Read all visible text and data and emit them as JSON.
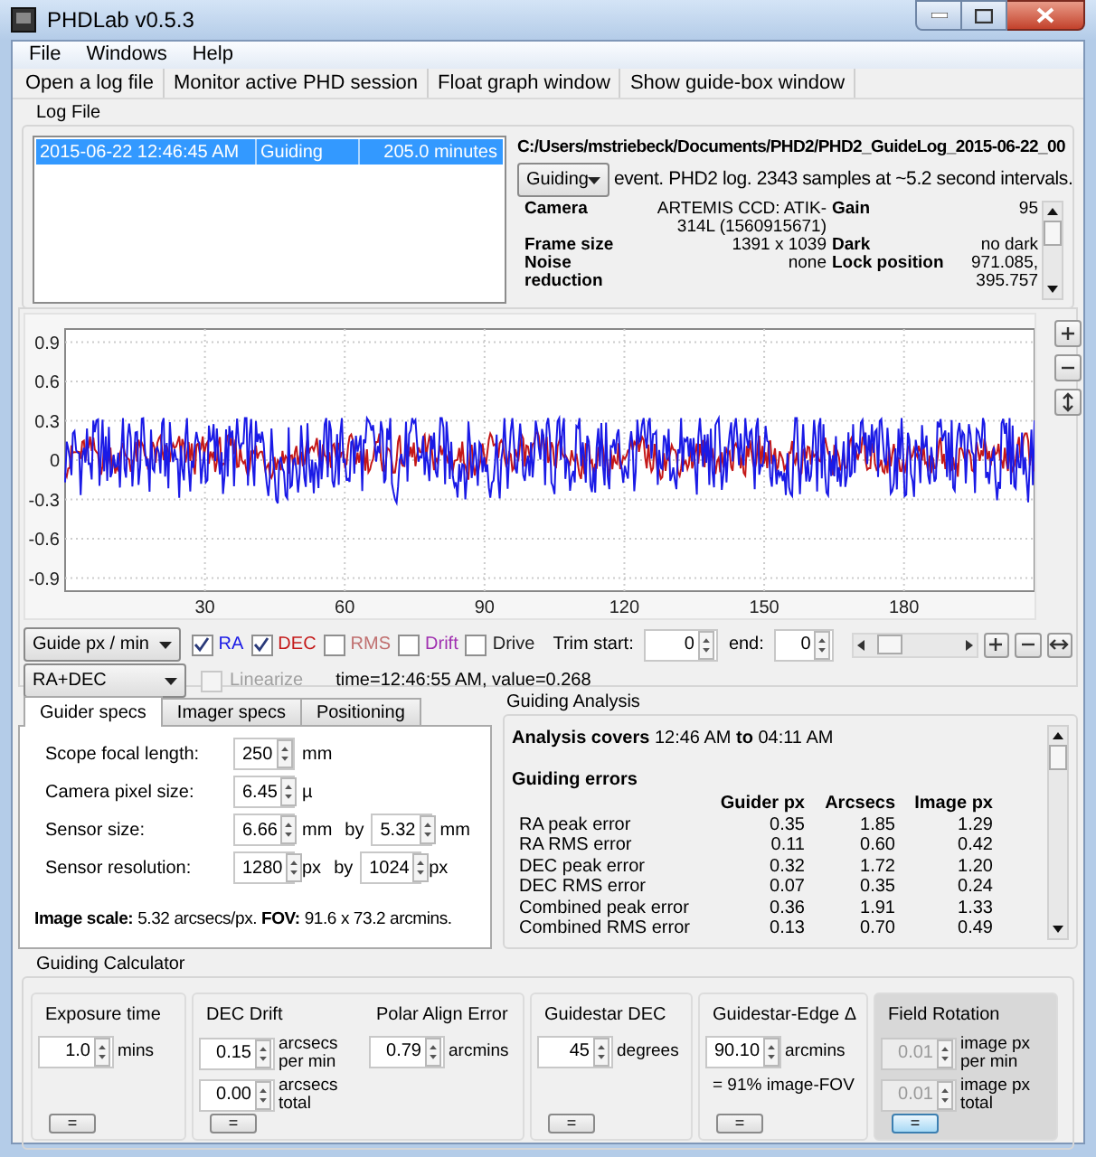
{
  "window": {
    "title": "PHDLab v0.5.3"
  },
  "menu": [
    {
      "label": "File"
    },
    {
      "label": "Windows"
    },
    {
      "label": "Help"
    }
  ],
  "toolbar": [
    {
      "label": "Open a log file"
    },
    {
      "label": "Monitor active PHD session"
    },
    {
      "label": "Float graph window"
    },
    {
      "label": "Show guide-box window"
    }
  ],
  "log_file": {
    "title": "Log File",
    "sessions": [
      {
        "date": "2015-06-22 12:46:45 AM",
        "type": "Guiding",
        "duration": "205.0 minutes",
        "selected": true
      }
    ],
    "path": "C:/Users/mstriebeck/Documents/PHD2/PHD2_GuideLog_2015-06-22_00",
    "mode": "Guiding",
    "summary": "event. PHD2 log.  2343 samples at ~5.2 second intervals.",
    "info": [
      {
        "label": "Camera",
        "value": "ARTEMIS CCD: ATIK-314L (1560915671)"
      },
      {
        "label": "Gain",
        "value": "95"
      },
      {
        "label": "Frame size",
        "value": "1391 x 1039"
      },
      {
        "label": "Dark",
        "value": "no dark"
      },
      {
        "label": "Noise reduction",
        "value": "none"
      },
      {
        "label": "Lock position",
        "value": "971.085, 395.757"
      }
    ]
  },
  "chart": {
    "y_ticks": [
      "0.9",
      "0.6",
      "0.3",
      "0",
      "-0.3",
      "-0.6",
      "-0.9"
    ],
    "x_ticks": [
      "30",
      "60",
      "90",
      "120",
      "150",
      "180"
    ],
    "units": "Guide px / min",
    "axes": "RA+DEC",
    "toggles": [
      {
        "label": "RA",
        "checked": true,
        "color": "#1a1ae6"
      },
      {
        "label": "DEC",
        "checked": true,
        "color": "#c41818"
      },
      {
        "label": "RMS",
        "checked": false,
        "color": "#c07070"
      },
      {
        "label": "Drift",
        "checked": false,
        "color": "#a030b0"
      },
      {
        "label": "Drive",
        "checked": false,
        "color": "#202020"
      }
    ],
    "linearize": {
      "label": "Linearize",
      "checked": false,
      "disabled": true
    },
    "trim_start_label": "Trim start:",
    "trim_start": "0",
    "trim_end_label": "end:",
    "trim_end": "0",
    "status": "time=12:46:55 AM, value=0.268"
  },
  "specs": {
    "tabs": [
      {
        "label": "Guider specs",
        "selected": true
      },
      {
        "label": "Imager specs",
        "selected": false
      },
      {
        "label": "Positioning",
        "selected": false
      }
    ],
    "fields": [
      {
        "label": "Scope focal length:",
        "value": "250",
        "unit": "mm"
      },
      {
        "label": "Camera pixel size:",
        "value": "6.45",
        "unit": "µ"
      },
      {
        "label": "Sensor size:",
        "value": "6.66",
        "unit": "mm",
        "joiner": "by",
        "value_2": "5.32",
        "unit_2": "mm"
      },
      {
        "label": "Sensor resolution:",
        "value": "1280",
        "unit": "px",
        "joiner": "by",
        "value_2": "1024",
        "unit_2": "px"
      }
    ],
    "image_scale": "**Image scale:** 5.32 arcsecs/px. **FOV:** 91.6 x 73.2 arcmins."
  },
  "analysis": {
    "title": "Guiding Analysis",
    "covers": "**Analysis covers** 12:46 AM **to** 04:11 AM",
    "heading": "Guiding errors",
    "columns": [
      "Guider px",
      "Arcsecs",
      "Image px"
    ],
    "rows": [
      {
        "label": "RA peak error",
        "values": [
          "0.35",
          "1.85",
          "1.29"
        ]
      },
      {
        "label": "RA RMS error",
        "values": [
          "0.11",
          "0.60",
          "0.42"
        ]
      },
      {
        "label": "DEC peak error",
        "values": [
          "0.32",
          "1.72",
          "1.20"
        ]
      },
      {
        "label": "DEC RMS error",
        "values": [
          "0.07",
          "0.35",
          "0.24"
        ]
      },
      {
        "label": "Combined peak error",
        "values": [
          "0.36",
          "1.91",
          "1.33"
        ]
      },
      {
        "label": "Combined RMS error",
        "values": [
          "0.13",
          "0.70",
          "0.49"
        ]
      }
    ]
  },
  "calculator": {
    "title": "Guiding Calculator",
    "panels": [
      {
        "shaded": false,
        "button": {
          "label": "=",
          "highlighted": false
        },
        "columns": [
          {
            "title": "Exposure time",
            "fields": [
              {
                "value": "1.0",
                "unit": "mins",
                "disabled": false
              }
            ]
          }
        ]
      },
      {
        "shaded": false,
        "button": {
          "label": "=",
          "highlighted": false
        },
        "columns": [
          {
            "title": "DEC Drift",
            "fields": [
              {
                "value": "0.15",
                "unit": "arcsecs per min",
                "disabled": false
              },
              {
                "value": "0.00",
                "unit": "arcsecs total",
                "disabled": false
              }
            ]
          },
          {
            "title": "Polar Align Error",
            "fields": [
              {
                "value": "0.79",
                "unit": "arcmins",
                "disabled": false
              }
            ]
          }
        ]
      },
      {
        "shaded": false,
        "button": {
          "label": "=",
          "highlighted": false
        },
        "columns": [
          {
            "title": "Guidestar DEC",
            "fields": [
              {
                "value": "45",
                "unit": "degrees",
                "disabled": false
              }
            ]
          }
        ]
      },
      {
        "shaded": false,
        "button": {
          "label": "=",
          "highlighted": false
        },
        "columns": [
          {
            "title": "Guidestar-Edge Δ",
            "fields": [
              {
                "value": "90.10",
                "unit": "arcmins",
                "disabled": false
              }
            ],
            "note": "= 91% image-FOV"
          }
        ]
      },
      {
        "shaded": true,
        "button": {
          "label": "=",
          "highlighted": true
        },
        "columns": [
          {
            "title": "Field Rotation",
            "fields": [
              {
                "value": "0.01",
                "unit": "image px per min",
                "disabled": true
              },
              {
                "value": "0.01",
                "unit": "image px total",
                "disabled": true
              }
            ]
          }
        ]
      }
    ]
  }
}
